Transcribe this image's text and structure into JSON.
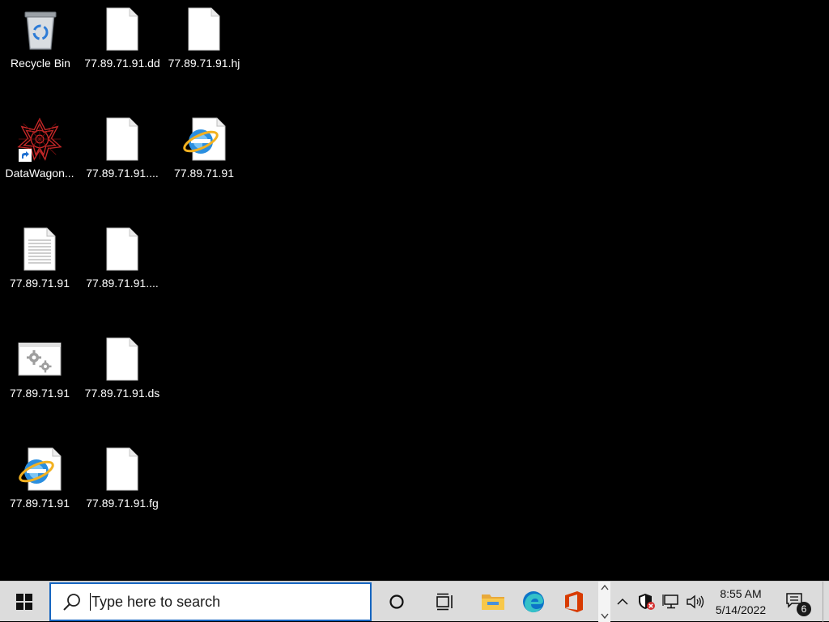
{
  "desktop": {
    "icons": [
      {
        "label": "Recycle Bin",
        "icon": "recycle-bin-icon"
      },
      {
        "label": "77.89.71.91.dd",
        "icon": "blank-file-icon"
      },
      {
        "label": "77.89.71.91.hj",
        "icon": "blank-file-icon"
      },
      {
        "label": "DataWagon...",
        "icon": "datawagon-shortcut-icon"
      },
      {
        "label": "77.89.71.91....",
        "icon": "blank-file-icon"
      },
      {
        "label": "77.89.71.91",
        "icon": "internet-explorer-file-icon"
      },
      {
        "label": "77.89.71.91",
        "icon": "text-document-icon"
      },
      {
        "label": "77.89.71.91....",
        "icon": "blank-file-icon"
      },
      {
        "label": "77.89.71.91",
        "icon": "config-settings-file-icon"
      },
      {
        "label": "77.89.71.91.ds",
        "icon": "blank-file-icon"
      },
      {
        "label": "77.89.71.91",
        "icon": "internet-explorer-file-icon"
      },
      {
        "label": "77.89.71.91.fg",
        "icon": "blank-file-icon"
      }
    ]
  },
  "taskbar": {
    "search_placeholder": "Type here to search",
    "pinned": [
      "start-windows-icon",
      "cortana-circle-icon",
      "task-view-icon",
      "file-explorer-icon",
      "edge-browser-icon",
      "office-icon"
    ],
    "tray": [
      "chevron-up-icon",
      "security-shield-icon",
      "network-icon",
      "volume-icon"
    ],
    "time": "8:55 AM",
    "date": "5/14/2022",
    "notification_count": "6"
  },
  "colors": {
    "desktop_bg": "#000000",
    "taskbar_bg": "#dcdcdc",
    "search_border": "#1565c0",
    "office_red": "#d83b01",
    "explorer_yellow": "#f8c84a"
  }
}
